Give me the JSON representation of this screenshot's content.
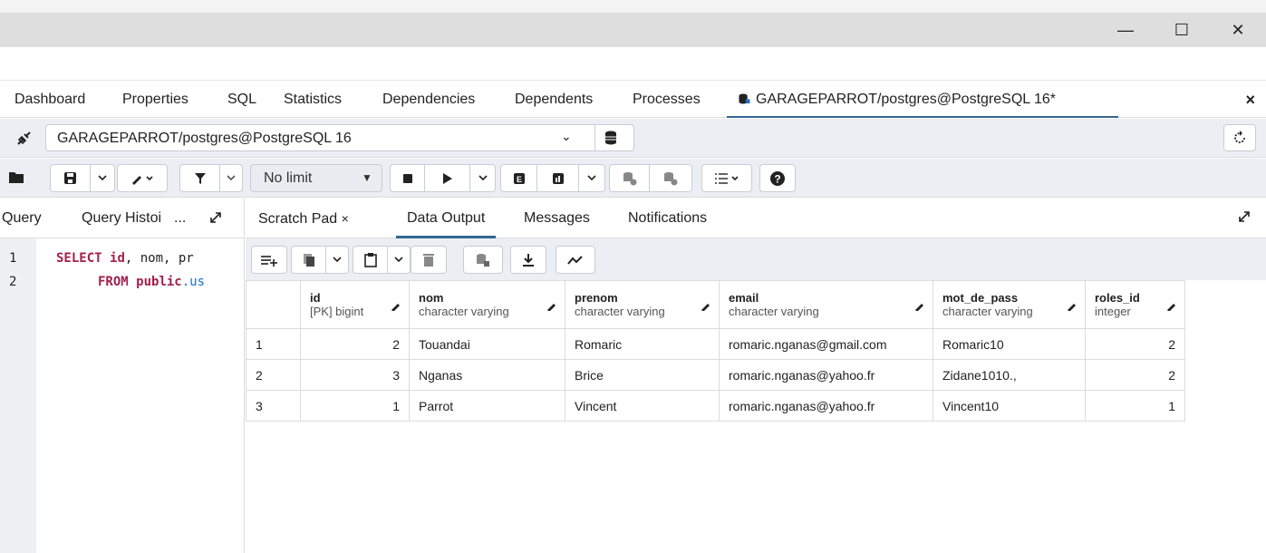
{
  "window": {
    "minimize": "—",
    "maximize": "☐",
    "close": "✕"
  },
  "tabs": [
    {
      "label": "Dashboard"
    },
    {
      "label": "Properties"
    },
    {
      "label": "SQL"
    },
    {
      "label": "Statistics"
    },
    {
      "label": "Dependencies"
    },
    {
      "label": "Dependents"
    },
    {
      "label": "Processes"
    },
    {
      "label": "GARAGEPARROT/postgres@PostgreSQL 16*"
    }
  ],
  "tab_close": "×",
  "connection": {
    "label": "GARAGEPARROT/postgres@PostgreSQL 16",
    "chevron": "⌄"
  },
  "toolbar": {
    "limit": "No limit"
  },
  "left_tabs": {
    "query": "Query",
    "history": "Query Histoi",
    "more": "..."
  },
  "editor": {
    "line1_num": "1",
    "line2_num": "2",
    "line1_kw": "SELECT",
    "line1_id": "id",
    "line1_rest": ", nom, pr",
    "line2_kw": "FROM",
    "line2_schema": "public",
    "line2_rest": ".us"
  },
  "right_tabs": {
    "scratch": "Scratch Pad",
    "scratch_close": "×",
    "data_output": "Data Output",
    "messages": "Messages",
    "notifications": "Notifications"
  },
  "columns": [
    {
      "name": "id",
      "type": "[PK] bigint"
    },
    {
      "name": "nom",
      "type": "character varying"
    },
    {
      "name": "prenom",
      "type": "character varying"
    },
    {
      "name": "email",
      "type": "character varying"
    },
    {
      "name": "mot_de_pass",
      "type": "character varying"
    },
    {
      "name": "roles_id",
      "type": "integer"
    }
  ],
  "rows": [
    {
      "n": "1",
      "id": "2",
      "nom": "Touandai",
      "prenom": "Romaric",
      "email": "romaric.nganas@gmail.com",
      "mdp": "Romaric10",
      "role": "2"
    },
    {
      "n": "2",
      "id": "3",
      "nom": "Nganas",
      "prenom": "Brice",
      "email": "romaric.nganas@yahoo.fr",
      "mdp": "Zidane1010.,",
      "role": "2"
    },
    {
      "n": "3",
      "id": "1",
      "nom": "Parrot",
      "prenom": "Vincent",
      "email": "romaric.nganas@yahoo.fr",
      "mdp": "Vincent10",
      "role": "1"
    }
  ],
  "colors": {
    "accent": "#326690",
    "keyword": "#a3204b",
    "schema": "#1f6ec2"
  }
}
